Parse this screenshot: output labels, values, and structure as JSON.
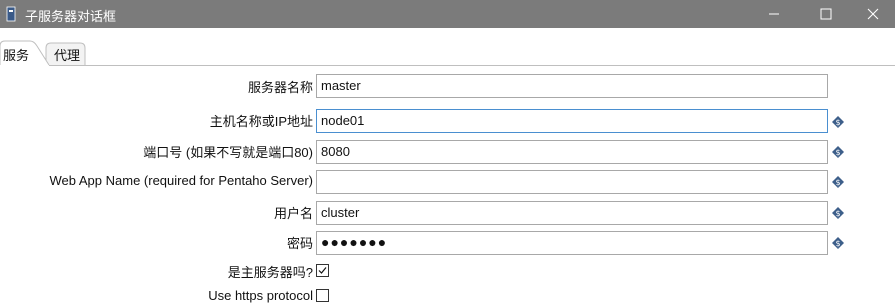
{
  "window": {
    "title": "子服务器对话框"
  },
  "tabs": [
    {
      "label": "服务",
      "active": true
    },
    {
      "label": "代理",
      "active": false
    }
  ],
  "form": {
    "server_name_label": "服务器名称",
    "server_name_value": "master",
    "hostname_label": "主机名称或IP地址",
    "hostname_value": "node01",
    "port_label": "端口号 (如果不写就是端口80)",
    "port_value": "8080",
    "webapp_label": "Web App Name (required for Pentaho Server)",
    "webapp_value": "",
    "username_label": "用户名",
    "username_value": "cluster",
    "password_label": "密码",
    "password_value": "●●●●●●●",
    "master_label": "是主服务器吗?",
    "master_checked": true,
    "https_label": "Use https protocol",
    "https_checked": false
  },
  "icons": {
    "app": "dialog-app-icon",
    "variable": "variable-diamond-icon"
  },
  "colors": {
    "titlebar": "#7b7b7b",
    "focus_border": "#4a8fd0",
    "variable_icon": "#3d5f8a"
  }
}
